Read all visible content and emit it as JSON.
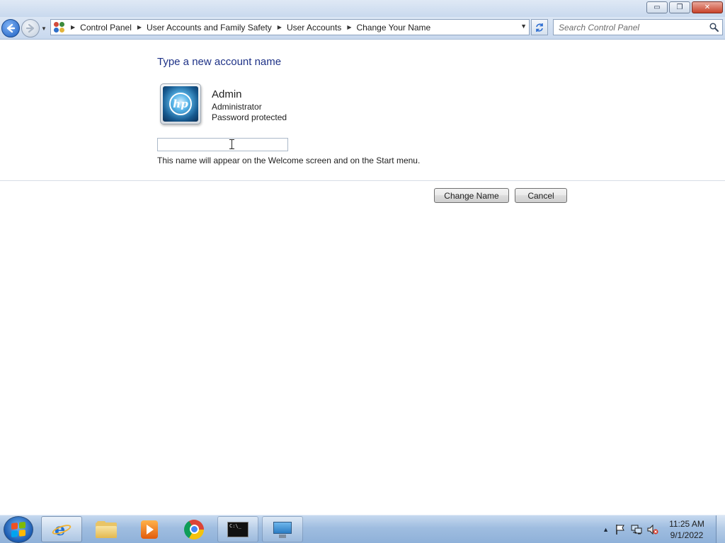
{
  "window": {
    "caption_buttons": {
      "minimize": "▭",
      "maximize": "❐",
      "close": "✕"
    }
  },
  "nav": {
    "breadcrumbs": [
      "Control Panel",
      "User Accounts and Family Safety",
      "User Accounts",
      "Change Your Name"
    ],
    "search_placeholder": "Search Control Panel"
  },
  "main": {
    "heading": "Type a new account name",
    "user": {
      "name": "Admin",
      "role": "Administrator",
      "status": "Password protected",
      "avatar_text": "hp"
    },
    "new_name_value": "",
    "hint": "This name will appear on the Welcome screen and on the Start menu.",
    "buttons": {
      "change": "Change Name",
      "cancel": "Cancel"
    }
  },
  "taskbar": {
    "items": [
      {
        "icon": "internet-explorer-icon",
        "state": "active"
      },
      {
        "icon": "windows-explorer-icon",
        "state": "normal"
      },
      {
        "icon": "media-player-icon",
        "state": "normal"
      },
      {
        "icon": "chrome-icon",
        "state": "normal"
      },
      {
        "icon": "command-prompt-icon",
        "state": "pinned",
        "text": "C:\\_"
      },
      {
        "icon": "control-panel-icon",
        "state": "pinned"
      }
    ],
    "clock": {
      "time": "11:25 AM",
      "date": "9/1/2022"
    }
  },
  "colors": {
    "heading": "#1e3287",
    "accent_blue": "#1d5fc2",
    "close_red": "#c8432b"
  }
}
